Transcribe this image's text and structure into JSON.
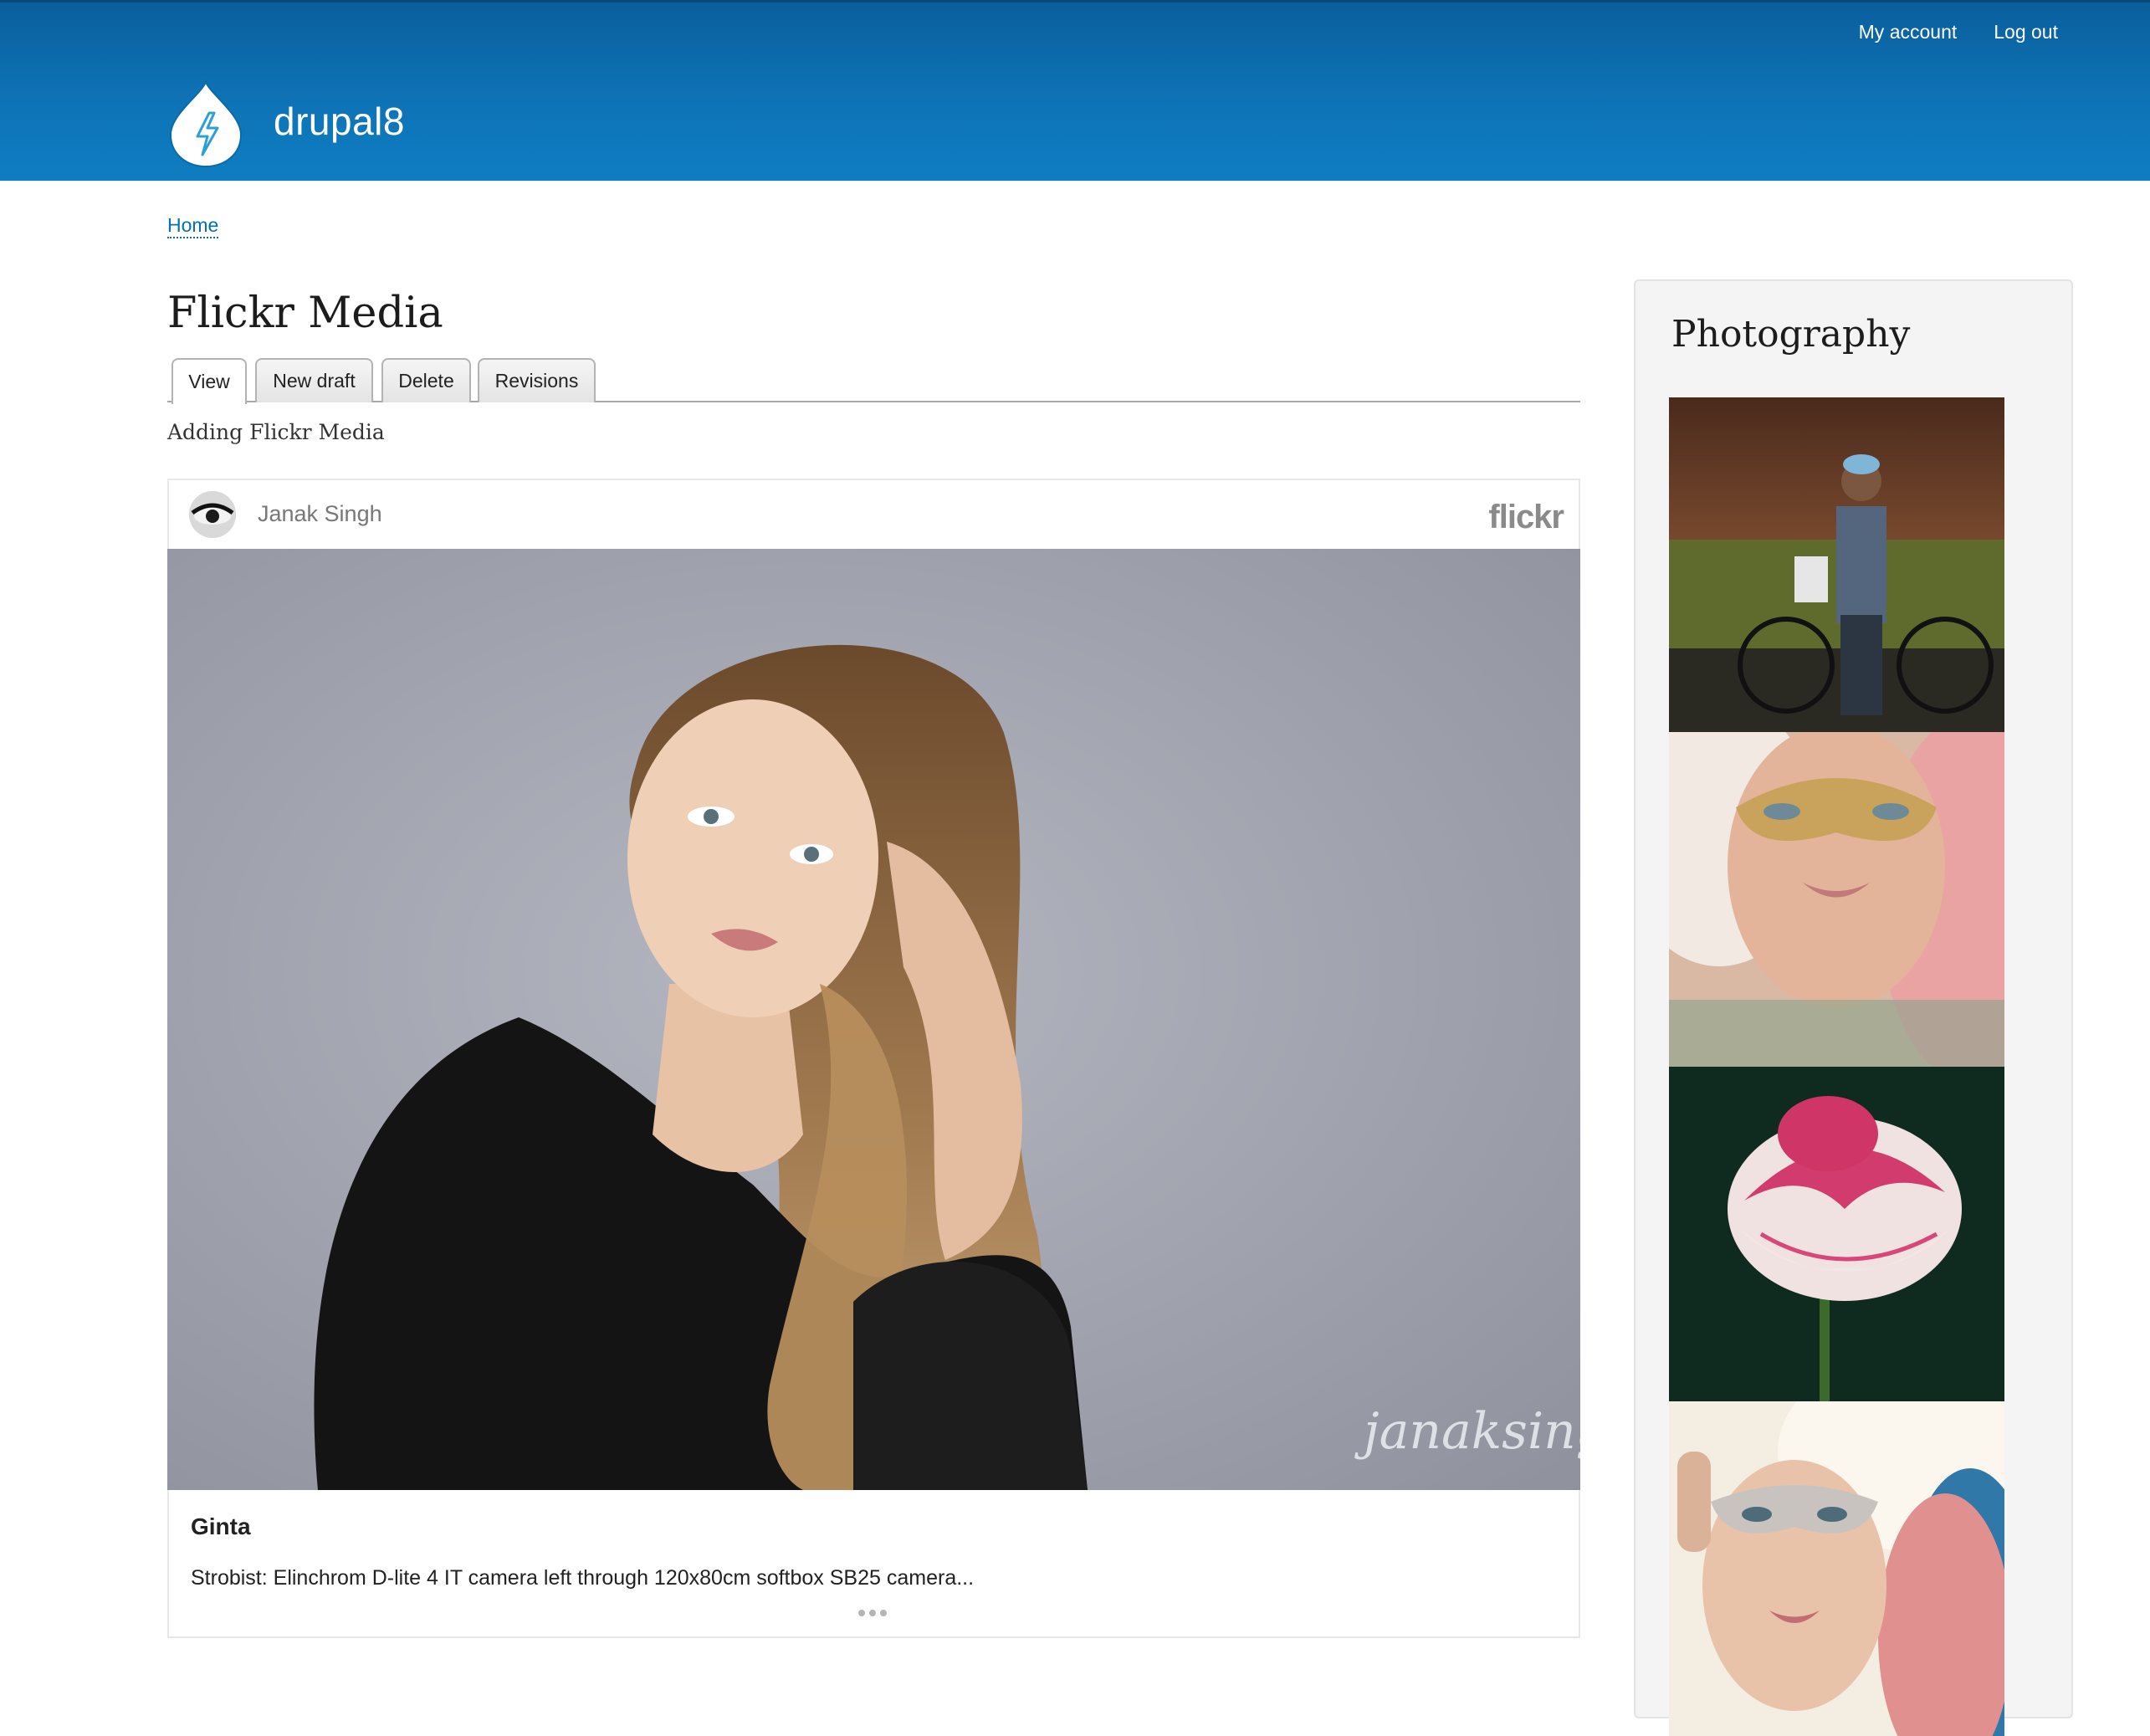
{
  "header": {
    "site_name": "drupal8",
    "logo_icon": "drupal-drop-icon",
    "secondary_menu": [
      "My account",
      "Log out"
    ],
    "colors": {
      "header_top": "#0a5f9c",
      "header_bottom": "#0f7dc2",
      "link": "#0071b3"
    }
  },
  "breadcrumb": {
    "home": "Home"
  },
  "main": {
    "title": "Flickr Media",
    "tabs": [
      {
        "label": "View",
        "active": true
      },
      {
        "label": "New draft",
        "active": false
      },
      {
        "label": "Delete",
        "active": false
      },
      {
        "label": "Revisions",
        "active": false
      }
    ],
    "body": "Adding Flickr Media"
  },
  "flickr_card": {
    "author": "Janak Singh",
    "provider_logo": "flickr",
    "photo_title": "Ginta",
    "photo_description": "Strobist: Elinchrom D-lite 4 IT camera left through 120x80cm softbox SB25 camera...",
    "watermark": "janaksingh",
    "more_icon": "ellipsis-icon"
  },
  "sidebar": {
    "title": "Photography",
    "thumbnails": [
      "man-with-bicycle",
      "woman-in-gold-mask",
      "pink-rose",
      "woman-in-feather-mask"
    ]
  }
}
